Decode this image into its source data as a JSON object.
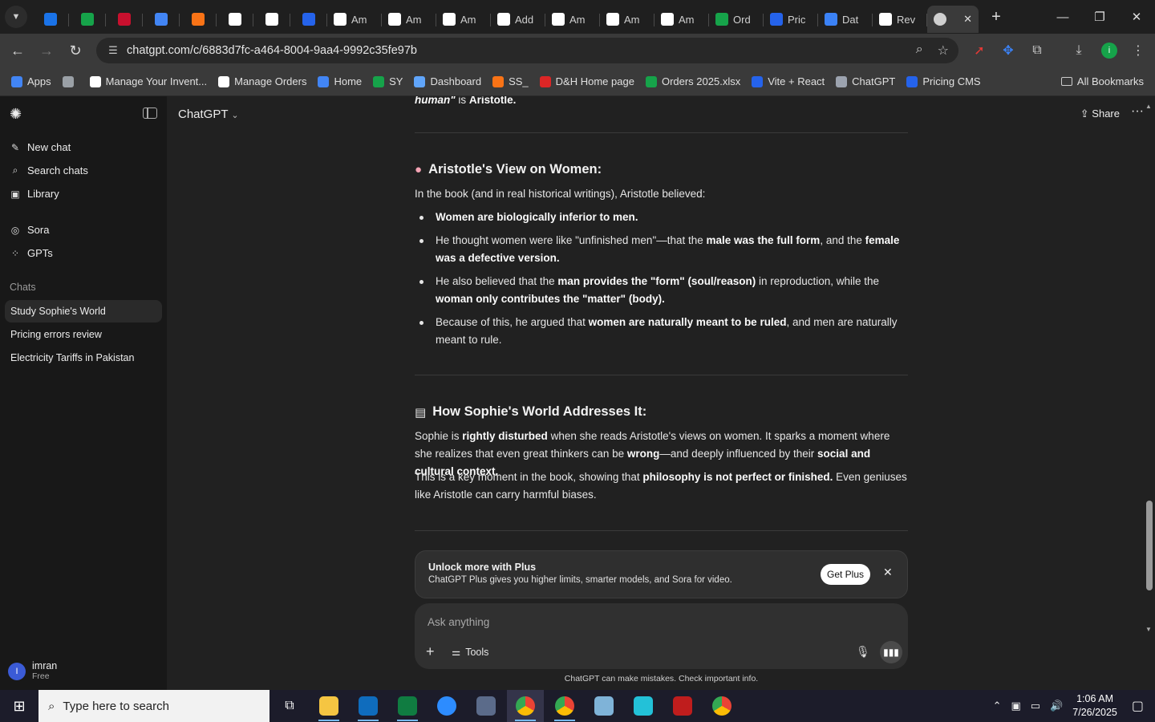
{
  "browser": {
    "tabs": [
      {
        "label": "",
        "icon": "tab-favicon",
        "color": "#1a73e8"
      },
      {
        "label": "",
        "icon": "tab-favicon",
        "color": "#16a34a"
      },
      {
        "label": "",
        "icon": "tab-favicon",
        "color": "#c8102e"
      },
      {
        "label": "",
        "icon": "tab-favicon",
        "color": "#4285f4"
      },
      {
        "label": "",
        "icon": "tab-favicon",
        "color": "#f97316"
      },
      {
        "label": "",
        "icon": "amazon-icon",
        "color": "#ffffff"
      },
      {
        "label": "",
        "icon": "amazon-icon",
        "color": "#ffffff"
      },
      {
        "label": "",
        "icon": "dollar-icon",
        "color": "#2563eb"
      },
      {
        "label": "Am",
        "icon": "amazon-icon",
        "color": "#ffffff"
      },
      {
        "label": "Am",
        "icon": "amazon-icon",
        "color": "#ffffff"
      },
      {
        "label": "Am",
        "icon": "amazon-icon",
        "color": "#ffffff"
      },
      {
        "label": "Add",
        "icon": "amazon-icon",
        "color": "#ffffff"
      },
      {
        "label": "Am",
        "icon": "amazon-icon",
        "color": "#ffffff"
      },
      {
        "label": "Am",
        "icon": "amazon-icon",
        "color": "#ffffff"
      },
      {
        "label": "Am",
        "icon": "amazon-icon",
        "color": "#ffffff"
      },
      {
        "label": "Ord",
        "icon": "globe-icon",
        "color": "#16a34a"
      },
      {
        "label": "Pric",
        "icon": "dollar-icon",
        "color": "#2563eb"
      },
      {
        "label": "Dat",
        "icon": "tab-favicon",
        "color": "#3b82f6"
      },
      {
        "label": "Rev",
        "icon": "amazon-icon",
        "color": "#ffffff"
      }
    ],
    "url": "chatgpt.com/c/6883d7fc-a464-8004-9aa4-9992c35fe97b",
    "bookmarks": [
      {
        "label": "Apps",
        "color": "#4285f4"
      },
      {
        "label": "",
        "color": "#9aa0a6"
      },
      {
        "label": "Manage Your Invent...",
        "color": "#ffffff"
      },
      {
        "label": "Manage Orders",
        "color": "#ffffff"
      },
      {
        "label": "Home",
        "color": "#4285f4"
      },
      {
        "label": "SY",
        "color": "#16a34a"
      },
      {
        "label": "Dashboard",
        "color": "#60a5fa"
      },
      {
        "label": "SS_",
        "color": "#f97316"
      },
      {
        "label": "D&H Home page",
        "color": "#dc2626"
      },
      {
        "label": "Orders 2025.xlsx",
        "color": "#16a34a"
      },
      {
        "label": "Vite + React",
        "color": "#2563eb"
      },
      {
        "label": "ChatGPT",
        "color": "#9ca3af"
      },
      {
        "label": "Pricing CMS",
        "color": "#2563eb"
      }
    ],
    "all_bookmarks": "All Bookmarks"
  },
  "sidebar": {
    "nav": [
      {
        "label": "New chat",
        "icon": "edit-icon"
      },
      {
        "label": "Search chats",
        "icon": "search-icon"
      },
      {
        "label": "Library",
        "icon": "library-icon"
      },
      {
        "label": "Sora",
        "icon": "sora-icon"
      },
      {
        "label": "GPTs",
        "icon": "gpts-icon"
      }
    ],
    "chats_heading": "Chats",
    "chats": [
      {
        "label": "Study Sophie's World",
        "active": true
      },
      {
        "label": "Pricing errors review",
        "active": false
      },
      {
        "label": "Electricity Tariffs in Pakistan",
        "active": false
      }
    ],
    "user": {
      "initial": "I",
      "name": "imran",
      "plan": "Free"
    }
  },
  "header": {
    "model": "ChatGPT",
    "share": "Share"
  },
  "conversation": {
    "top_fragment_a": "human\"",
    "top_fragment_b": " is ",
    "top_fragment_c": "Aristotle.",
    "section1_title": "Aristotle's View on Women:",
    "section1_intro": "In the book (and in real historical writings), Aristotle believed:",
    "b1": "Women are biologically inferior to men.",
    "b2_a": "He thought women were like \"unfinished men\"—that the ",
    "b2_b": "male was the full form",
    "b2_c": ", and the ",
    "b2_d": "female was a defective version.",
    "b3_a": "He also believed that the ",
    "b3_b": "man provides the \"form\" (soul/reason)",
    "b3_c": " in reproduction, while the ",
    "b3_d": "woman only contributes the \"matter\" (body).",
    "b4_a": "Because of this, he argued that ",
    "b4_b": "women are naturally meant to be ruled",
    "b4_c": ", and men are naturally meant to rule.",
    "section2_title": "How Sophie's World Addresses It:",
    "p1_a": "Sophie is ",
    "p1_b": "rightly disturbed",
    "p1_c": " when she reads Aristotle's views on women. It sparks a moment where she realizes that even great thinkers can be ",
    "p1_d": "wrong",
    "p1_e": "—and deeply influenced by their ",
    "p1_f": "social and cultural context.",
    "p2_a": "This is a key moment in the book, showing that ",
    "p2_b": "philosophy is not perfect or finished.",
    "p2_c": " Even geniuses like Aristotle can carry harmful biases."
  },
  "plus_banner": {
    "title": "Unlock more with Plus",
    "text": "ChatGPT Plus gives you higher limits, smarter models, and Sora for video.",
    "button": "Get Plus"
  },
  "composer": {
    "placeholder": "Ask anything",
    "value": "",
    "tools": "Tools"
  },
  "disclaimer": "ChatGPT can make mistakes. Check important info.",
  "taskbar": {
    "search_placeholder": "Type here to search",
    "time": "1:06 AM",
    "date": "7/26/2025"
  }
}
